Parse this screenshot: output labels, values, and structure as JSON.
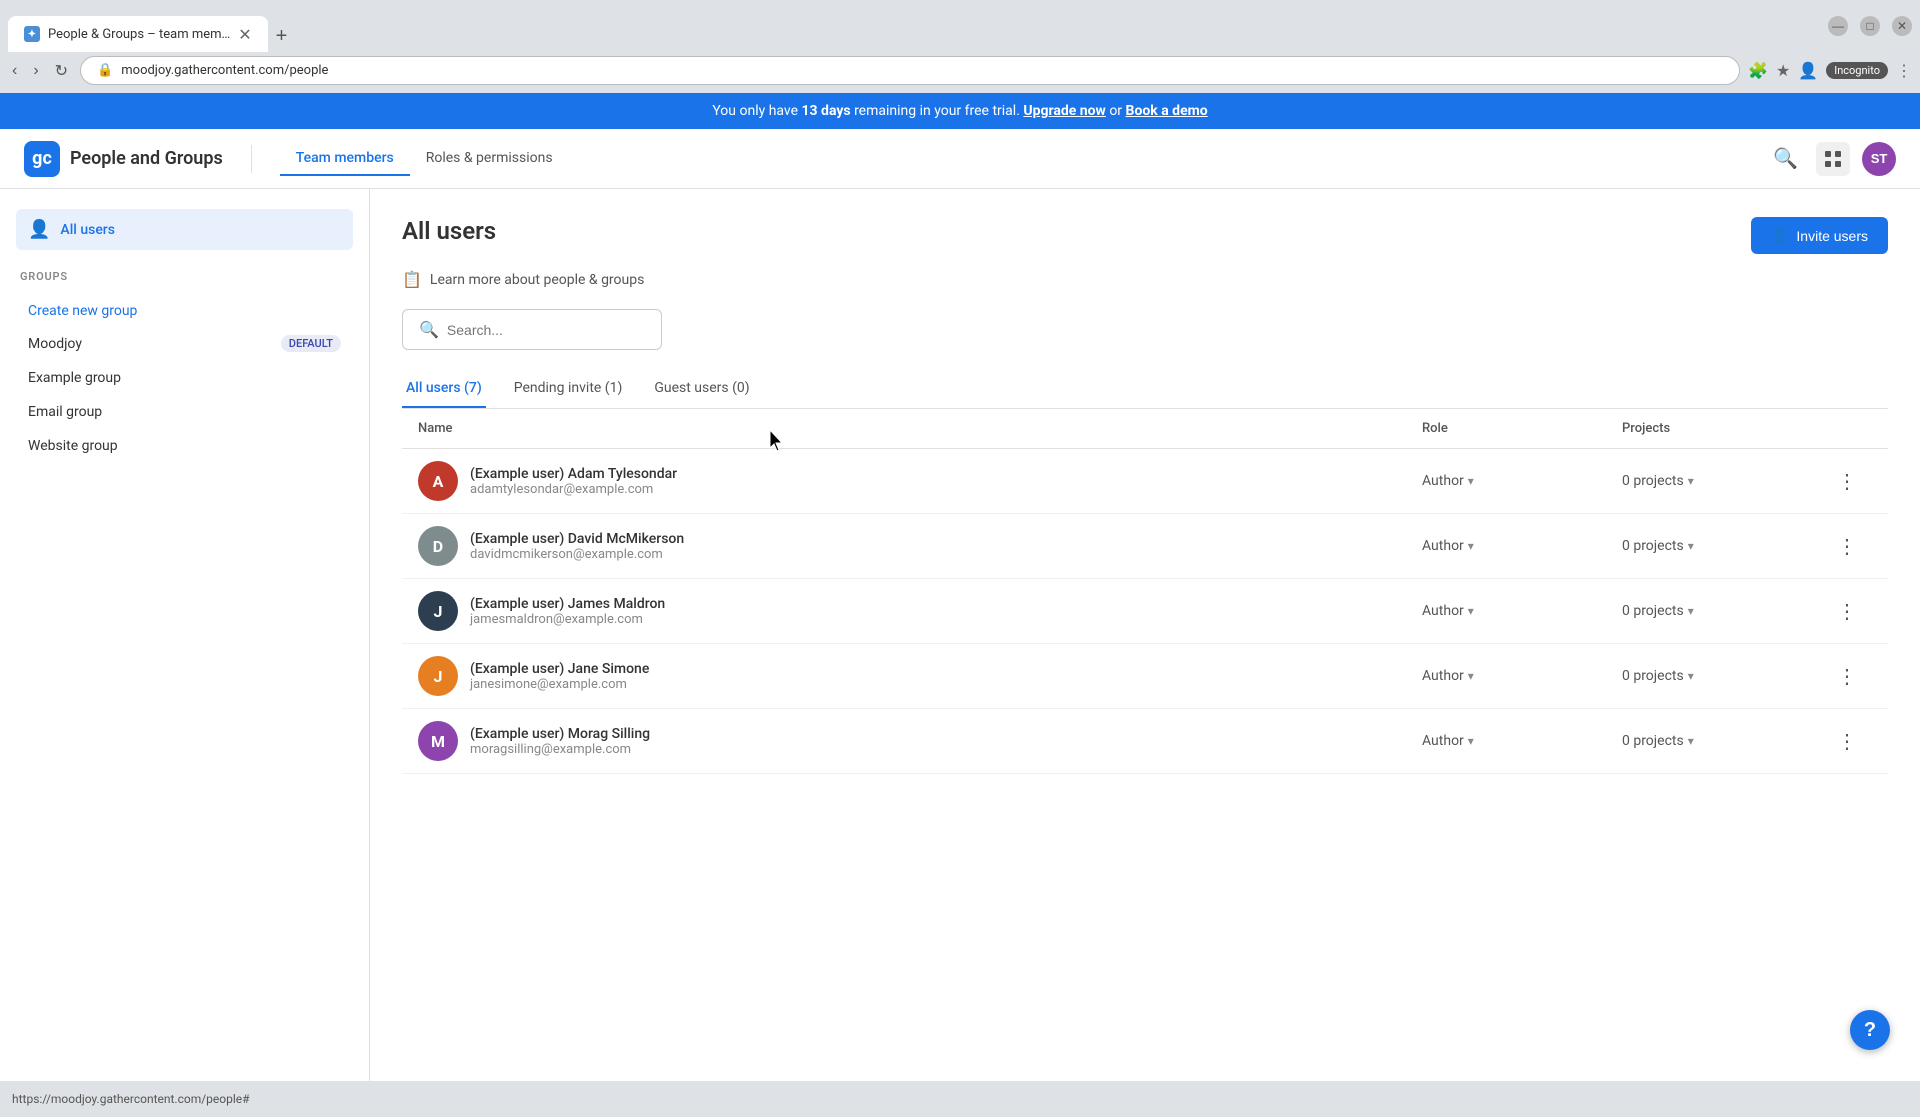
{
  "browser": {
    "tab_title": "People & Groups – team mem…",
    "tab_favicon": "✦",
    "new_tab_icon": "+",
    "address": "moodjoy.gathercontent.com/people",
    "back_btn": "‹",
    "forward_btn": "›",
    "reload_btn": "↻",
    "incognito_label": "Incognito",
    "status_bar_url": "https://moodjoy.gathercontent.com/people#"
  },
  "trial_banner": {
    "text_before": "You only have ",
    "days": "13 days",
    "text_middle": " remaining in your free trial. ",
    "upgrade_label": "Upgrade now",
    "text_or": " or ",
    "demo_label": "Book a demo"
  },
  "header": {
    "logo_text": "gc",
    "title": "People and Groups",
    "nav_items": [
      {
        "label": "Team members",
        "active": true
      },
      {
        "label": "Roles & permissions",
        "active": false
      }
    ],
    "avatar_initials": "ST"
  },
  "sidebar": {
    "all_users_label": "All users",
    "groups_section_label": "GROUPS",
    "create_group_label": "Create new group",
    "groups": [
      {
        "name": "Moodjoy",
        "badge": "DEFAULT"
      },
      {
        "name": "Example group",
        "badge": ""
      },
      {
        "name": "Email group",
        "badge": ""
      },
      {
        "name": "Website group",
        "badge": ""
      }
    ]
  },
  "content": {
    "page_title": "All users",
    "invite_btn_label": "Invite users",
    "learn_more_label": "Learn more about people & groups",
    "search_placeholder": "Search...",
    "tabs": [
      {
        "label": "All users (7)",
        "active": true
      },
      {
        "label": "Pending invite (1)",
        "active": false
      },
      {
        "label": "Guest users (0)",
        "active": false
      }
    ],
    "table_columns": [
      {
        "label": "Name"
      },
      {
        "label": "Role"
      },
      {
        "label": "Projects"
      },
      {
        "label": ""
      }
    ],
    "users": [
      {
        "name": "(Example user) Adam Tylesondar",
        "email": "adamtylesondar@example.com",
        "role": "Author",
        "projects": "0 projects",
        "avatar_class": "avatar-adam",
        "avatar_letter": "A"
      },
      {
        "name": "(Example user) David McMikerson",
        "email": "davidmcmikerson@example.com",
        "role": "Author",
        "projects": "0 projects",
        "avatar_class": "avatar-david",
        "avatar_letter": "D"
      },
      {
        "name": "(Example user) James Maldron",
        "email": "jamesmaldron@example.com",
        "role": "Author",
        "projects": "0 projects",
        "avatar_class": "avatar-james",
        "avatar_letter": "J"
      },
      {
        "name": "(Example user) Jane Simone",
        "email": "janesimone@example.com",
        "role": "Author",
        "projects": "0 projects",
        "avatar_class": "avatar-jane",
        "avatar_letter": "J"
      },
      {
        "name": "(Example user) Morag Silling",
        "email": "moragsilling@example.com",
        "role": "Author",
        "projects": "0 projects",
        "avatar_class": "avatar-morag",
        "avatar_letter": "M"
      }
    ]
  },
  "help_btn_label": "?",
  "icons": {
    "search": "🔍",
    "user": "👤",
    "more": "⋮",
    "learn": "📋",
    "dropdown": "▾",
    "invite": "👤+"
  }
}
